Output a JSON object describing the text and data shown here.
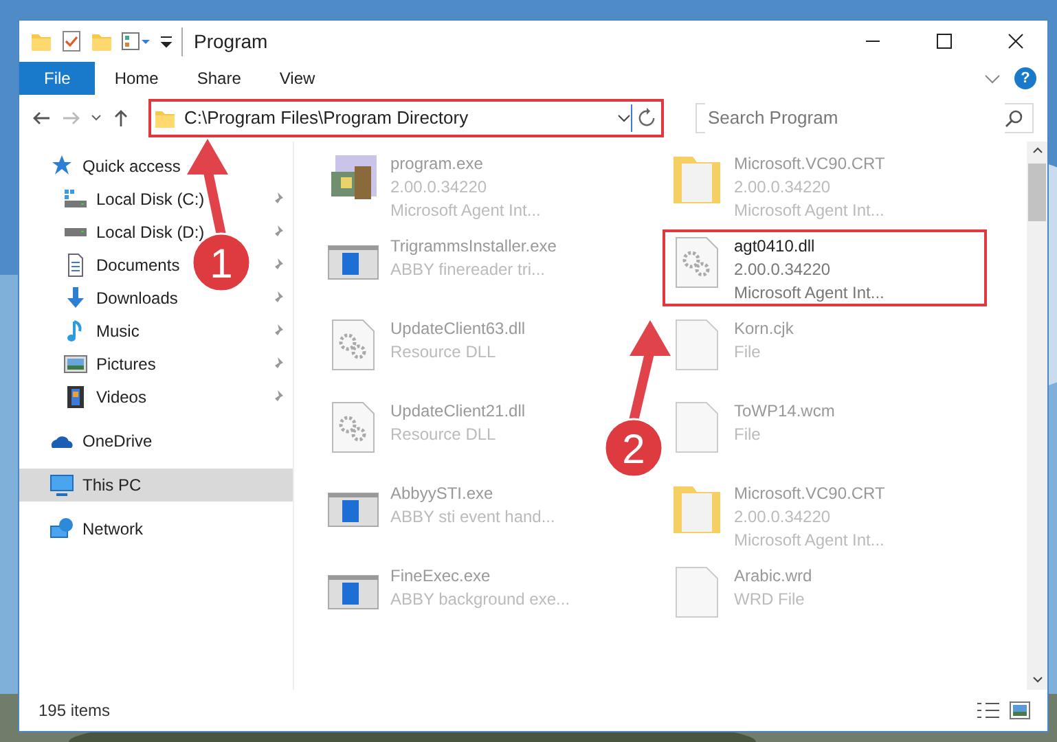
{
  "window": {
    "title": "Program"
  },
  "ribbon_tabs": [
    {
      "label": "File",
      "selected": true
    },
    {
      "label": "Home",
      "selected": false
    },
    {
      "label": "Share",
      "selected": false
    },
    {
      "label": "View",
      "selected": false
    }
  ],
  "help": "?",
  "address": {
    "path": "C:\\Program Files\\Program Directory",
    "highlighted": true
  },
  "search": {
    "placeholder": "Search Program"
  },
  "nav": [
    {
      "label": "Quick access",
      "kind": "star",
      "selected": false,
      "children": [
        {
          "label": "Local Disk (C:)",
          "kind": "drive-c",
          "pinned": true
        },
        {
          "label": "Local Disk (D:)",
          "kind": "drive",
          "pinned": true
        },
        {
          "label": "Documents",
          "kind": "documents",
          "pinned": true
        },
        {
          "label": "Downloads",
          "kind": "downloads",
          "pinned": true
        },
        {
          "label": "Music",
          "kind": "music",
          "pinned": true
        },
        {
          "label": "Pictures",
          "kind": "pictures",
          "pinned": true
        },
        {
          "label": "Videos",
          "kind": "videos",
          "pinned": true
        }
      ]
    },
    {
      "label": "OneDrive",
      "kind": "cloud",
      "selected": false
    },
    {
      "label": "This PC",
      "kind": "pc",
      "selected": true
    },
    {
      "label": "Network",
      "kind": "network",
      "selected": false
    }
  ],
  "files": [
    {
      "name": "program.exe",
      "details": [
        "2.00.0.34220",
        "Microsoft Agent Int..."
      ],
      "kind": "installer",
      "highlighted": false
    },
    {
      "name": "Microsoft.VC90.CRT",
      "details": [
        "2.00.0.34220",
        "Microsoft Agent Int..."
      ],
      "kind": "folder",
      "highlighted": false
    },
    {
      "name": "TrigrammsInstaller.exe",
      "details": [
        "ABBY finereader tri..."
      ],
      "kind": "app",
      "highlighted": false
    },
    {
      "name": "agt0410.dll",
      "details": [
        "2.00.0.34220",
        "Microsoft Agent Int..."
      ],
      "kind": "dll",
      "highlighted": true
    },
    {
      "name": "UpdateClient63.dll",
      "details": [
        "Resource DLL"
      ],
      "kind": "dll",
      "highlighted": false
    },
    {
      "name": "Korn.cjk",
      "details": [
        "File"
      ],
      "kind": "blank",
      "highlighted": false
    },
    {
      "name": "UpdateClient21.dll",
      "details": [
        "Resource DLL"
      ],
      "kind": "dll",
      "highlighted": false
    },
    {
      "name": "ToWP14.wcm",
      "details": [
        "File"
      ],
      "kind": "blank",
      "highlighted": false
    },
    {
      "name": "AbbyySTI.exe",
      "details": [
        "ABBY sti event hand..."
      ],
      "kind": "app",
      "highlighted": false
    },
    {
      "name": "Microsoft.VC90.CRT",
      "details": [
        "2.00.0.34220",
        "Microsoft Agent Int..."
      ],
      "kind": "folder",
      "highlighted": false
    },
    {
      "name": "FineExec.exe",
      "details": [
        "ABBY background exe..."
      ],
      "kind": "app",
      "highlighted": false
    },
    {
      "name": "Arabic.wrd",
      "details": [
        "WRD File"
      ],
      "kind": "blank",
      "highlighted": false
    }
  ],
  "callouts": [
    {
      "number": "1"
    },
    {
      "number": "2"
    }
  ],
  "status_bar": {
    "count": "195 items"
  }
}
